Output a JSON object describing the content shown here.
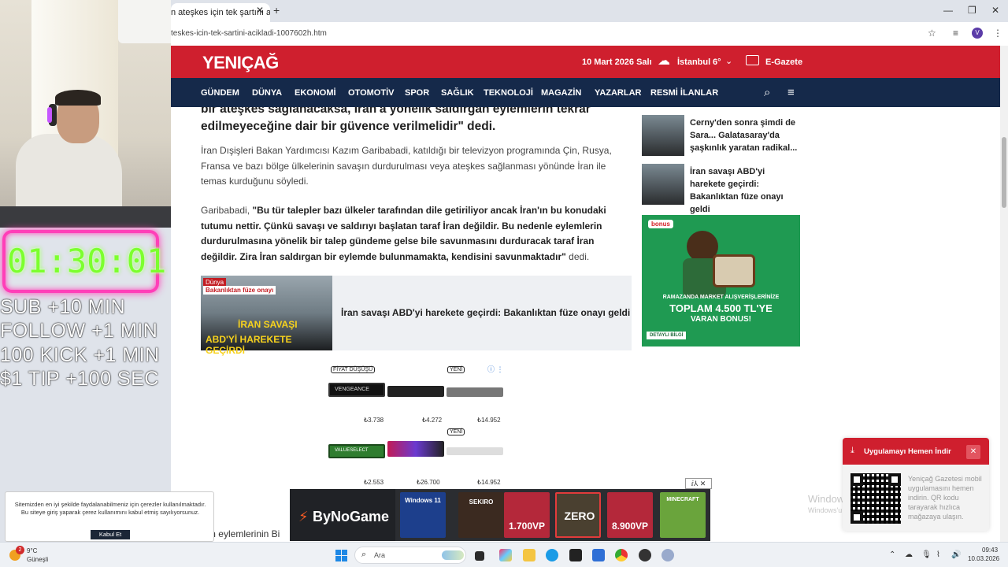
{
  "browser": {
    "tab_title": "n ateşkes için tek şartını açık",
    "tab_close": "✕",
    "new_tab": "+",
    "url": "teskes-icin-tek-sartini-acikladi-1007602h.htm",
    "profile_initial": "V"
  },
  "site": {
    "logo": "YENIÇAĞ",
    "date": "10 Mart 2026 Salı",
    "city": "İstanbul",
    "temp": "6°",
    "egazete": "E-Gazete",
    "nav": [
      "GÜNDEM",
      "DÜNYA",
      "EKONOMİ",
      "OTOMOTİV",
      "SPOR",
      "SAĞLIK",
      "TEKNOLOJİ",
      "MAGAZİN",
      "YAZARLAR",
      "RESMİ İLANLAR"
    ]
  },
  "article": {
    "lead_line1": "bir ateşkes sağlanacaksa, İran'a yönelik saldırgan eylemlerin tekrar",
    "lead_line2": "edilmeyeceğine dair bir güvence verilmelidir\" dedi.",
    "para1": "İran Dışişleri Bakan Yardımcısı Kazım Garibabadi, katıldığı bir televizyon programında Çin, Rusya, Fransa ve bazı bölge ülkelerinin savaşın durdurulması veya ateşkes sağlanması yönünde İran ile temas kurduğunu söyledi.",
    "para2_prefix": "Garibabadi, ",
    "para2_quote": "\"Bu tür talepler bazı ülkeler tarafından dile getiriliyor ancak İran'ın bu konudaki tutumu nettir. Çünkü savaşı ve saldırıyı başlatan taraf İran değildir. Bu nedenle eylemlerin durdurulmasına yönelik bir talep gündeme gelse bile savunmasını durduracak taraf İran değildir. Zira İran saldırgan bir eylemde bulunmamakta, kendisini savunmaktadır\"",
    "para2_suffix": " dedi.",
    "related_title": "İran savaşı ABD'yi harekete geçirdi: Bakanlıktan füze onayı geldi",
    "related_img_tag1": "Dünya",
    "related_img_tag2": "Bakanlıktan füze onayı",
    "related_img_cap1": "İRAN SAVAŞI",
    "related_img_cap2": "ABD'Yİ HAREKETE GEÇİRDİ",
    "bottom_text": "n'ın eylemlerinin Bi"
  },
  "ram_ad": {
    "tag_discount": "FİYAT DÜŞÜŞÜ",
    "tag_new1": "YENİ",
    "tag_new2": "YENİ",
    "prices": [
      "₺3.738",
      "₺4.272",
      "₺14.952",
      "₺2.553",
      "₺26.700",
      "₺14.952"
    ],
    "brand_1": "VENGEANCE",
    "brand_4": "VALUESELECT"
  },
  "sidebar": {
    "items": [
      {
        "title": "Cerny'den sonra şimdi de Sara... Galatasaray'da şaşkınlık yaratan radikal..."
      },
      {
        "title": "İran savaşı ABD'yi harekete geçirdi: Bakanlıktan füze onayı geldi"
      }
    ],
    "banner": {
      "bonus": "bonus",
      "line1": "RAMAZANDA MARKET ALIŞVERİŞLERİNİZE",
      "line2": "TOPLAM 4.500 TL'YE",
      "line3": "VARAN BONUS!",
      "button": "DETAYLI BİLGİ"
    }
  },
  "adbar": {
    "brand": "ByNoGame",
    "close": "ⅈ⅄ ✕",
    "products": [
      {
        "label": "Windows 11",
        "color": "#1d3f8c"
      },
      {
        "label": "SEKIRO",
        "color": "#3b2a20"
      },
      {
        "label": "1.700VP",
        "color": "#b4283a"
      },
      {
        "label": "ZERO",
        "color": "#4a4030"
      },
      {
        "label": "8.900VP",
        "color": "#b4283a"
      },
      {
        "label": "MINECRAFT",
        "color": "#6aa43c"
      }
    ]
  },
  "cookie": {
    "text": "Sitemizden en iyi şekilde faydalanabilmeniz için çerezler kullanılmaktadır. Bu siteye giriş yaparak çerez kullanımını kabul etmiş sayılıyorsunuz.",
    "button": "Kabul Et"
  },
  "app_popup": {
    "title": "Uygulamayı Hemen İndir",
    "text": "Yeniçağ Gazetesi mobil uygulamasını hemen indirin. QR kodu tarayarak hızlıca mağazaya ulaşın.",
    "watermark1": "Windows'u",
    "watermark2": "Windows'u etkin"
  },
  "stream": {
    "timer": "01:30:01",
    "rules": [
      "SUB +10 MIN",
      "FOLLOW +1 MIN",
      "100 KICK +1 MIN",
      "$1 TIP +100 SEC"
    ]
  },
  "taskbar": {
    "weather_badge": "2",
    "temp": "9°C",
    "condition": "Güneşli",
    "search_placeholder": "Ara",
    "time": "09:43",
    "date": "10.03.2026"
  },
  "colors": {
    "site_red": "#cf1f2e",
    "nav_navy": "#15294a",
    "timer_green": "#7cff2e",
    "timer_border": "#ff3fb8"
  }
}
